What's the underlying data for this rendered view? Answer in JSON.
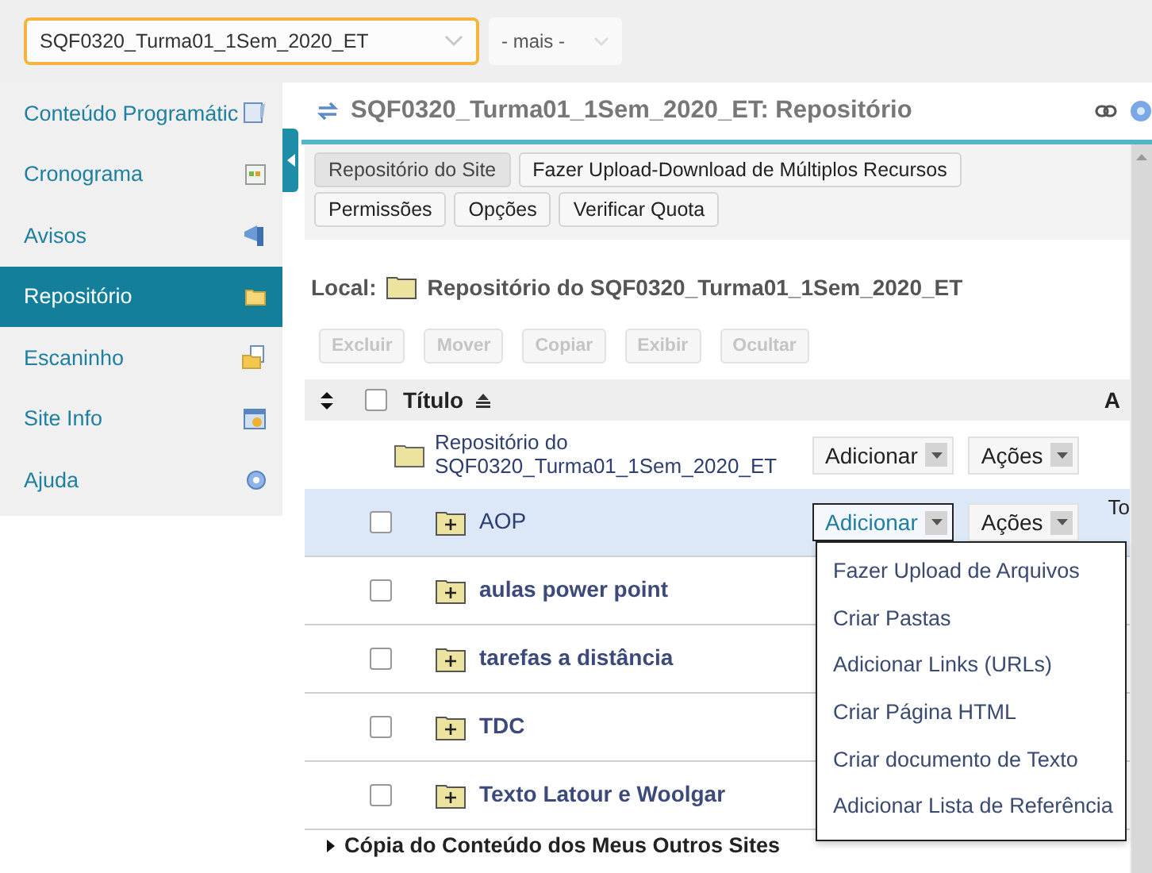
{
  "site_selector": {
    "value": "SQF0320_Turma01_1Sem_2020_ET"
  },
  "more_selector": {
    "value": "- mais -"
  },
  "sidebar": {
    "items": [
      {
        "label": "Conteúdo Programátic",
        "selected": false
      },
      {
        "label": "Cronograma",
        "selected": false
      },
      {
        "label": "Avisos",
        "selected": false
      },
      {
        "label": "Repositório",
        "selected": true
      },
      {
        "label": "Escaninho",
        "selected": false
      },
      {
        "label": "Site Info",
        "selected": false
      },
      {
        "label": "Ajuda",
        "selected": false
      }
    ]
  },
  "page_title": "SQF0320_Turma01_1Sem_2020_ET: Repositório",
  "toolbar": [
    {
      "label": "Repositório do Site",
      "selected": true
    },
    {
      "label": "Fazer Upload-Download de Múltiplos Recursos",
      "selected": false
    },
    {
      "label": "Permissões",
      "selected": false
    },
    {
      "label": "Opções",
      "selected": false
    },
    {
      "label": "Verificar Quota",
      "selected": false
    }
  ],
  "location": {
    "label": "Local:",
    "path": "Repositório do SQF0320_Turma01_1Sem_2020_ET"
  },
  "bulk_actions": [
    {
      "label": "Excluir",
      "disabled": true
    },
    {
      "label": "Mover",
      "disabled": true
    },
    {
      "label": "Copiar",
      "disabled": true
    },
    {
      "label": "Exibir",
      "disabled": true
    },
    {
      "label": "Ocultar",
      "disabled": true
    }
  ],
  "table": {
    "columns": [
      "Título",
      "A"
    ],
    "header_checked": false,
    "rows": [
      {
        "kind": "root",
        "title": "Repositório do SQF0320_Turma01_1Sem_2020_ET",
        "add": "Adicionar",
        "actions": "Ações",
        "selected": false,
        "menu_open": false
      },
      {
        "kind": "folder",
        "title": "AOP",
        "add": "Adicionar",
        "actions": "Ações",
        "extra": "To",
        "checked": false,
        "selected": true,
        "menu_open": true
      },
      {
        "kind": "folder",
        "title": "aulas power point",
        "checked": false,
        "selected": false
      },
      {
        "kind": "folder",
        "title": "tarefas a distância",
        "checked": false,
        "selected": false
      },
      {
        "kind": "folder",
        "title": "TDC",
        "checked": false,
        "selected": false
      },
      {
        "kind": "folder",
        "title": "Texto Latour e Woolgar",
        "checked": false,
        "selected": false
      }
    ]
  },
  "add_menu": {
    "items": [
      "Fazer Upload de Arquivos",
      "Criar Pastas",
      "Adicionar Links (URLs)",
      "Criar Página HTML",
      "Criar documento de Texto",
      "Adicionar Lista de Referência"
    ]
  },
  "footer_section": {
    "label": "Cópia do Conteúdo dos Meus Outros Sites",
    "expanded": false
  }
}
